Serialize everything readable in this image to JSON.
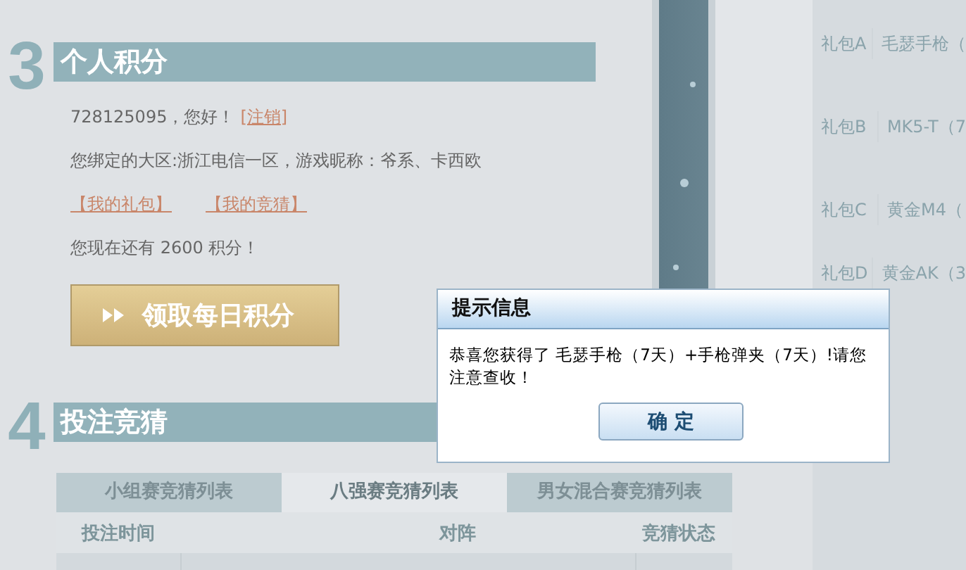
{
  "points_section": {
    "number": "3",
    "title": "个人积分",
    "greeting": "728125095，您好！",
    "logout_link": "[注销]",
    "binding": "您绑定的大区:浙江电信一区，游戏昵称：爷系、卡西欧",
    "links": [
      "【我的礼包】",
      "【我的竞猜】"
    ],
    "points": "您现在还有 2600 积分！",
    "claim_button": "领取每日积分"
  },
  "betting_section": {
    "number": "4",
    "title": "投注竞猜",
    "tabs": [
      {
        "label": "小组赛竞猜列表",
        "selected": false
      },
      {
        "label": "八强赛竞猜列表",
        "selected": true
      },
      {
        "label": "男女混合赛竞猜列表",
        "selected": false
      }
    ],
    "columns": [
      "投注时间",
      "对阵",
      "竞猜状态"
    ]
  },
  "gift_table": {
    "rows": [
      {
        "package": "礼包A",
        "item": "毛瑟手枪（"
      },
      {
        "package": "礼包B",
        "item": "MK5-T（7"
      },
      {
        "package": "礼包C",
        "item": "黄金M4（"
      },
      {
        "package": "礼包D",
        "item": "黄金AK（3"
      }
    ]
  },
  "dialog": {
    "title": "提示信息",
    "message": "恭喜您获得了 毛瑟手枪（7天）+手枪弹夹（7天）!请您注意查收！",
    "button": "确 定"
  }
}
